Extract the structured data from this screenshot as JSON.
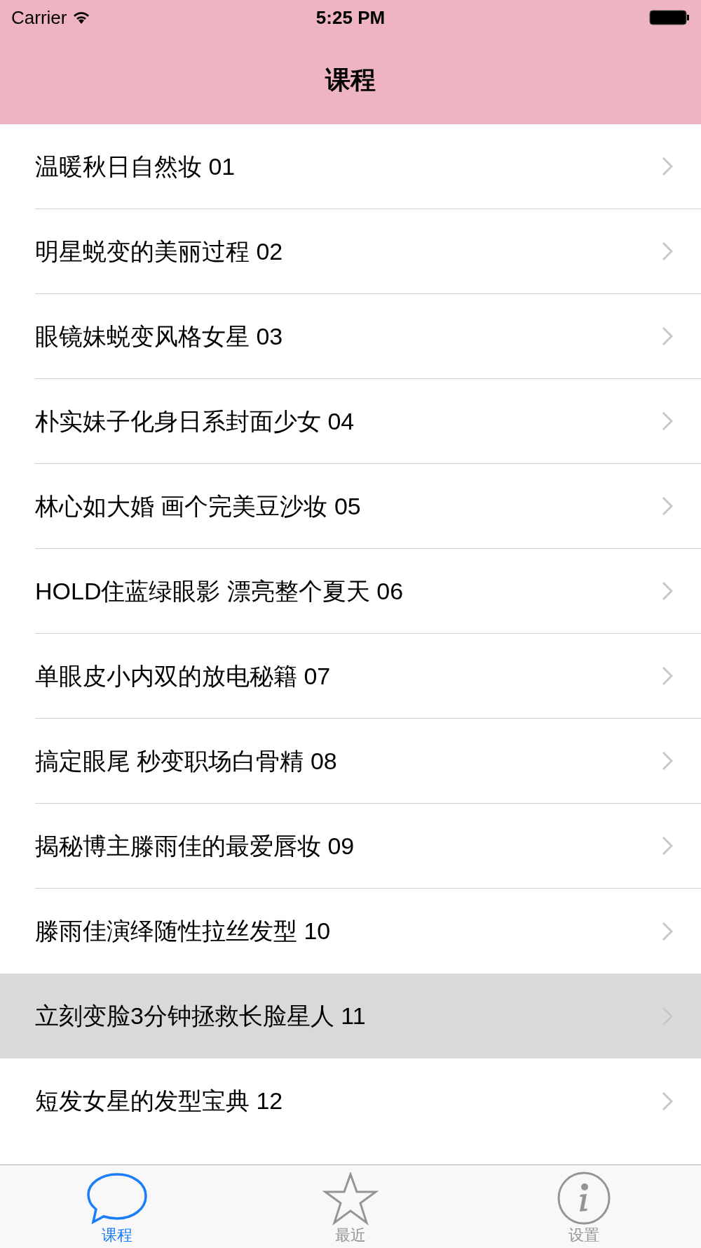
{
  "status_bar": {
    "carrier": "Carrier",
    "time": "5:25 PM"
  },
  "nav_bar": {
    "title": "课程"
  },
  "rows": [
    {
      "label": "温暖秋日自然妆 01",
      "selected": false
    },
    {
      "label": "明星蜕变的美丽过程 02",
      "selected": false
    },
    {
      "label": "眼镜妹蜕变风格女星 03",
      "selected": false
    },
    {
      "label": "朴实妹子化身日系封面少女 04",
      "selected": false
    },
    {
      "label": "林心如大婚 画个完美豆沙妆 05",
      "selected": false
    },
    {
      "label": "HOLD住蓝绿眼影 漂亮整个夏天 06",
      "selected": false
    },
    {
      "label": "单眼皮小内双的放电秘籍 07",
      "selected": false
    },
    {
      "label": "搞定眼尾 秒变职场白骨精 08",
      "selected": false
    },
    {
      "label": "揭秘博主滕雨佳的最爱唇妆 09",
      "selected": false
    },
    {
      "label": "滕雨佳演绎随性拉丝发型 10",
      "selected": false
    },
    {
      "label": "立刻变脸3分钟拯救长脸星人 11",
      "selected": true
    },
    {
      "label": "短发女星的发型宝典 12",
      "selected": false
    }
  ],
  "tab_bar": [
    {
      "kind": "chat",
      "label": "课程",
      "selected": true
    },
    {
      "kind": "star",
      "label": "最近",
      "selected": false
    },
    {
      "kind": "info",
      "label": "设置",
      "selected": false
    }
  ]
}
